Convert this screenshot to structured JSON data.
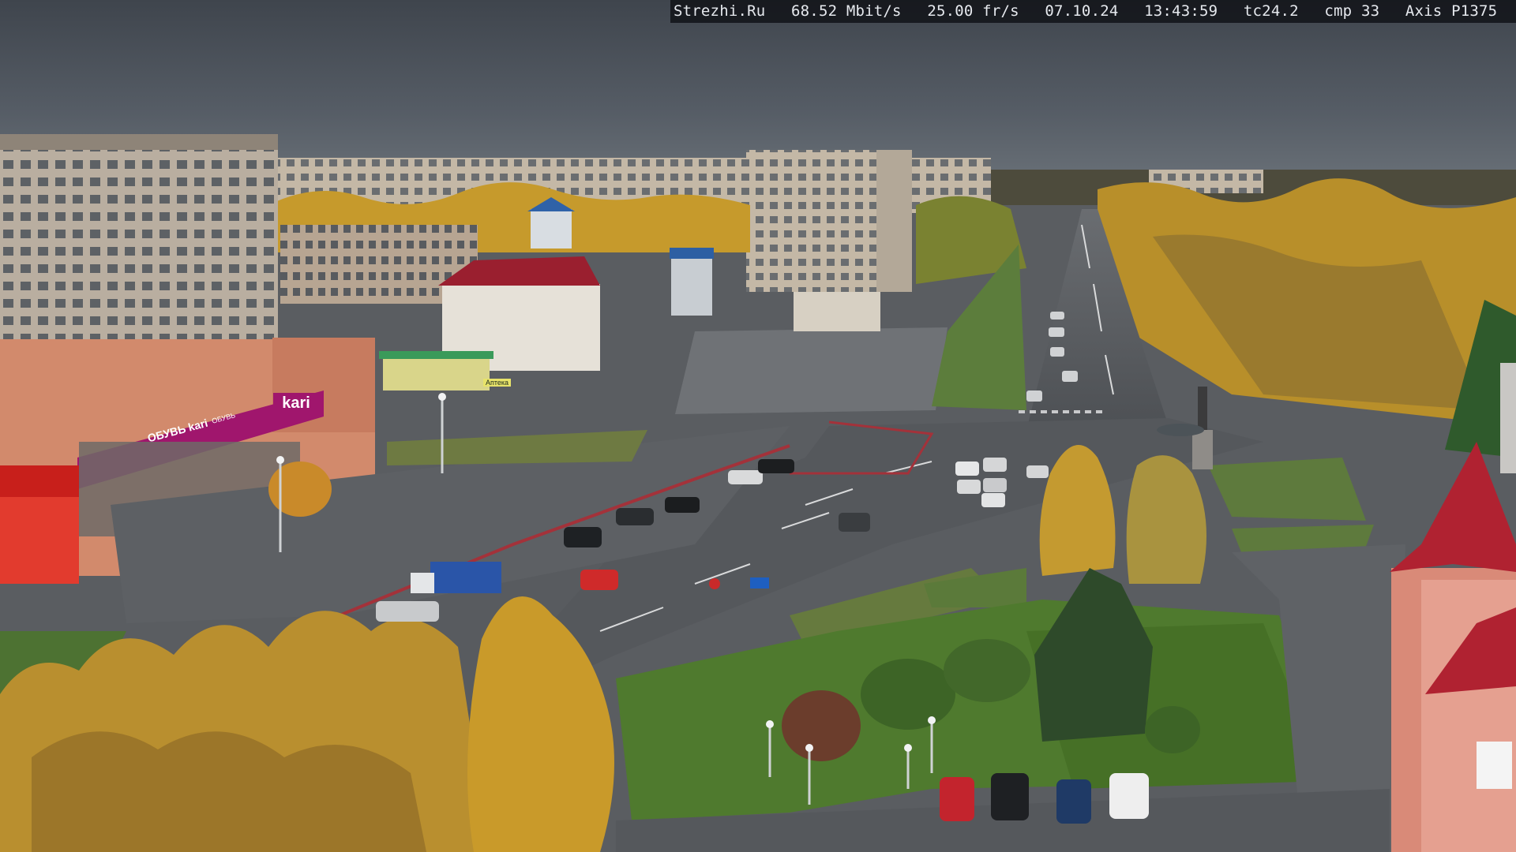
{
  "overlay": {
    "site": "Strezhi.Ru",
    "bitrate": "68.52 Mbit/s",
    "framerate": "25.00 fr/s",
    "date": "07.10.24",
    "time": "13:43:59",
    "tc": "tc24.2",
    "cmp": "cmp 33",
    "camera": "Axis P1375"
  },
  "signage": {
    "store_main": "kari",
    "store_banner": "ОБУВЬ kari",
    "store_small": "ОБУВЬ",
    "pharmacy": "Аптека"
  },
  "colors": {
    "sky": "#4c535b",
    "asphalt": "#55585c",
    "birch_gold": "#c99a2a",
    "kari_magenta": "#a0166d",
    "roof_red": "#a4232e"
  }
}
